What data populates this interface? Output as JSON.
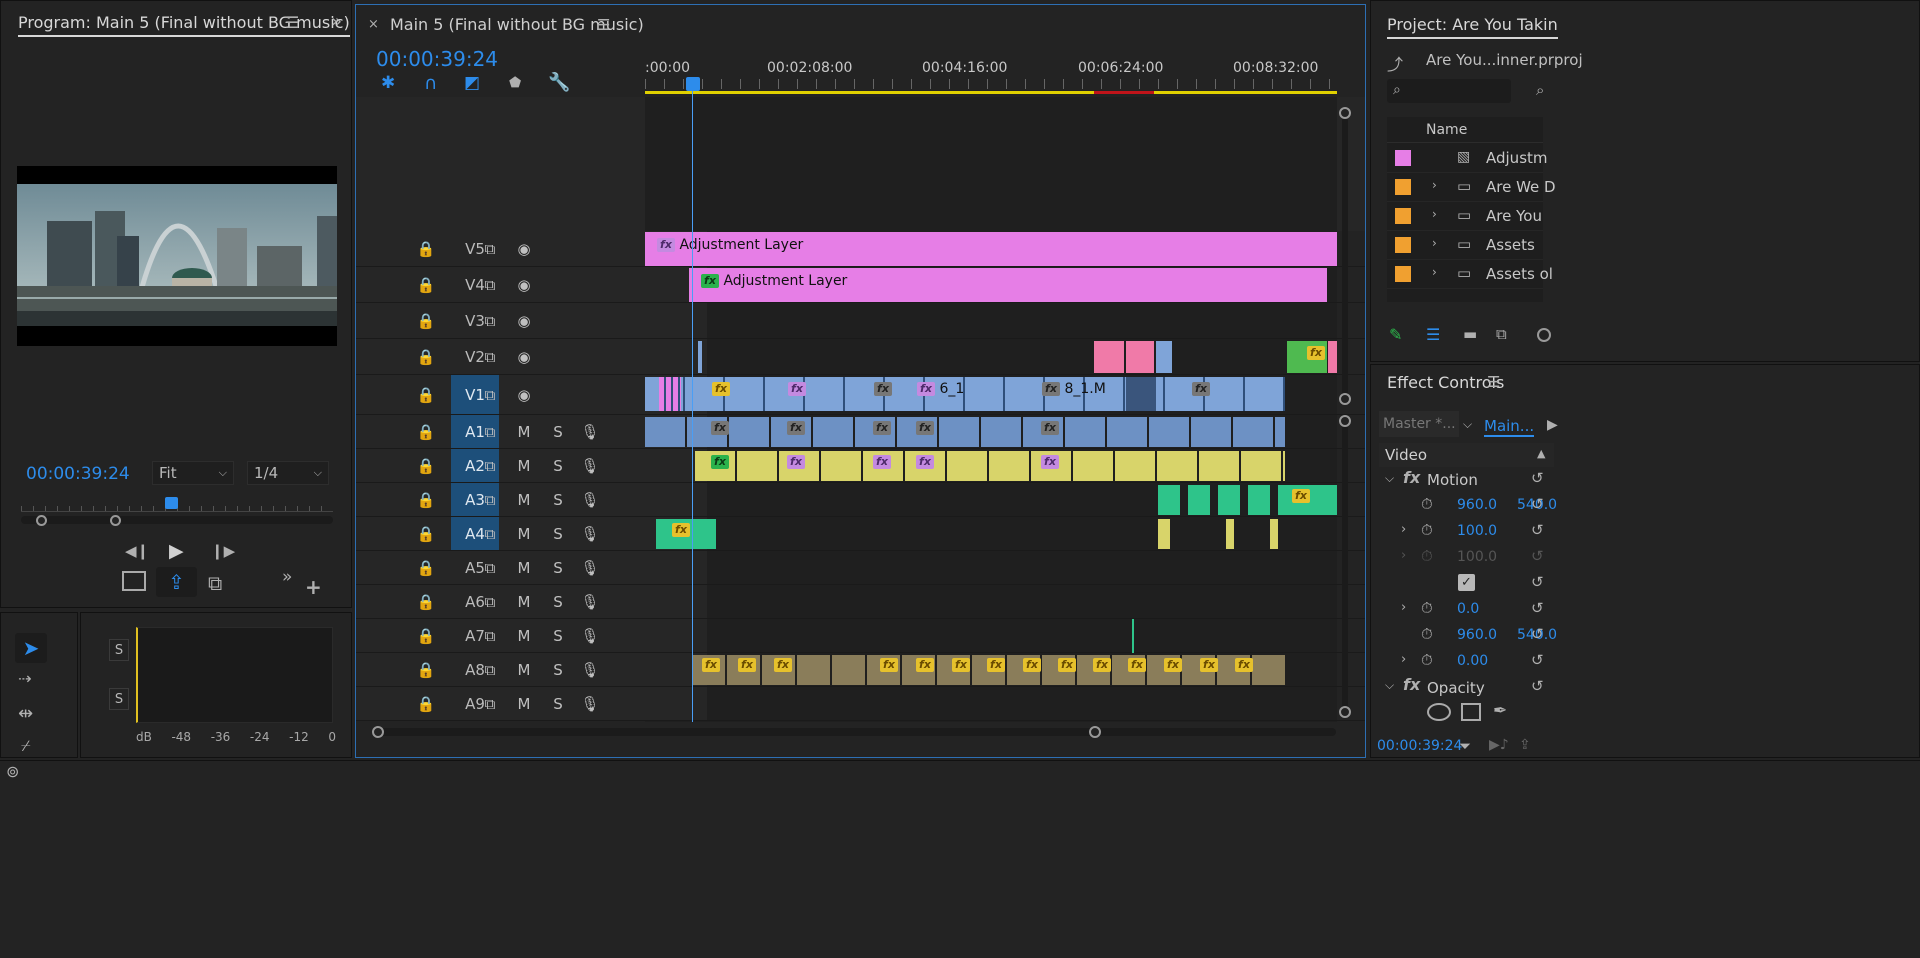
{
  "program_monitor": {
    "title": "Program: Main 5 (Final without BG music)",
    "timecode": "00:00:39:24",
    "fit": "Fit",
    "resolution": "1/4"
  },
  "meter": {
    "s_label": "S",
    "labels": [
      "dB",
      "-48",
      "-36",
      "-24",
      "-12",
      "0"
    ]
  },
  "timeline": {
    "tab_title": "Main 5 (Final without BG music)",
    "timecode": "00:00:39:24",
    "ruler": [
      ":00:00",
      "00:02:08:00",
      "00:04:16:00",
      "00:06:24:00",
      "00:08:32:00"
    ],
    "video_tracks": [
      "V5",
      "V4",
      "V3",
      "V2",
      "V1"
    ],
    "audio_tracks": [
      "A1",
      "A2",
      "A3",
      "A4",
      "A5",
      "A6",
      "A7",
      "A8",
      "A9"
    ],
    "m_label": "M",
    "s_label": "S",
    "clips": {
      "adj1": "Adjustment Layer",
      "adj2": "Adjustment Layer",
      "c61": "6_1",
      "c81": "8_1.M"
    }
  },
  "project": {
    "title": "Project: Are You Takin",
    "file": "Are You...inner.prproj",
    "search_placeholder": "",
    "column_name": "Name",
    "items": [
      {
        "name": "Adjustm",
        "color": "#e67ee6"
      },
      {
        "name": "Are We D",
        "color": "#f0a030"
      },
      {
        "name": "Are You",
        "color": "#f0a030"
      },
      {
        "name": "Assets",
        "color": "#f0a030"
      },
      {
        "name": "Assets ol",
        "color": "#f0a030"
      }
    ]
  },
  "effect_controls": {
    "title": "Effect Controls",
    "master": "Master *...",
    "main": "Main...",
    "video": "Video",
    "motion": "Motion",
    "opacity": "Opacity",
    "pos_x": "960.0",
    "pos_y": "540.0",
    "scale": "100.0",
    "scale_w": "100.0",
    "rotation": "0.0",
    "anchor_x": "960.0",
    "anchor_y": "540.0",
    "flicker": "0.00",
    "timecode": "00:00:39:24"
  }
}
